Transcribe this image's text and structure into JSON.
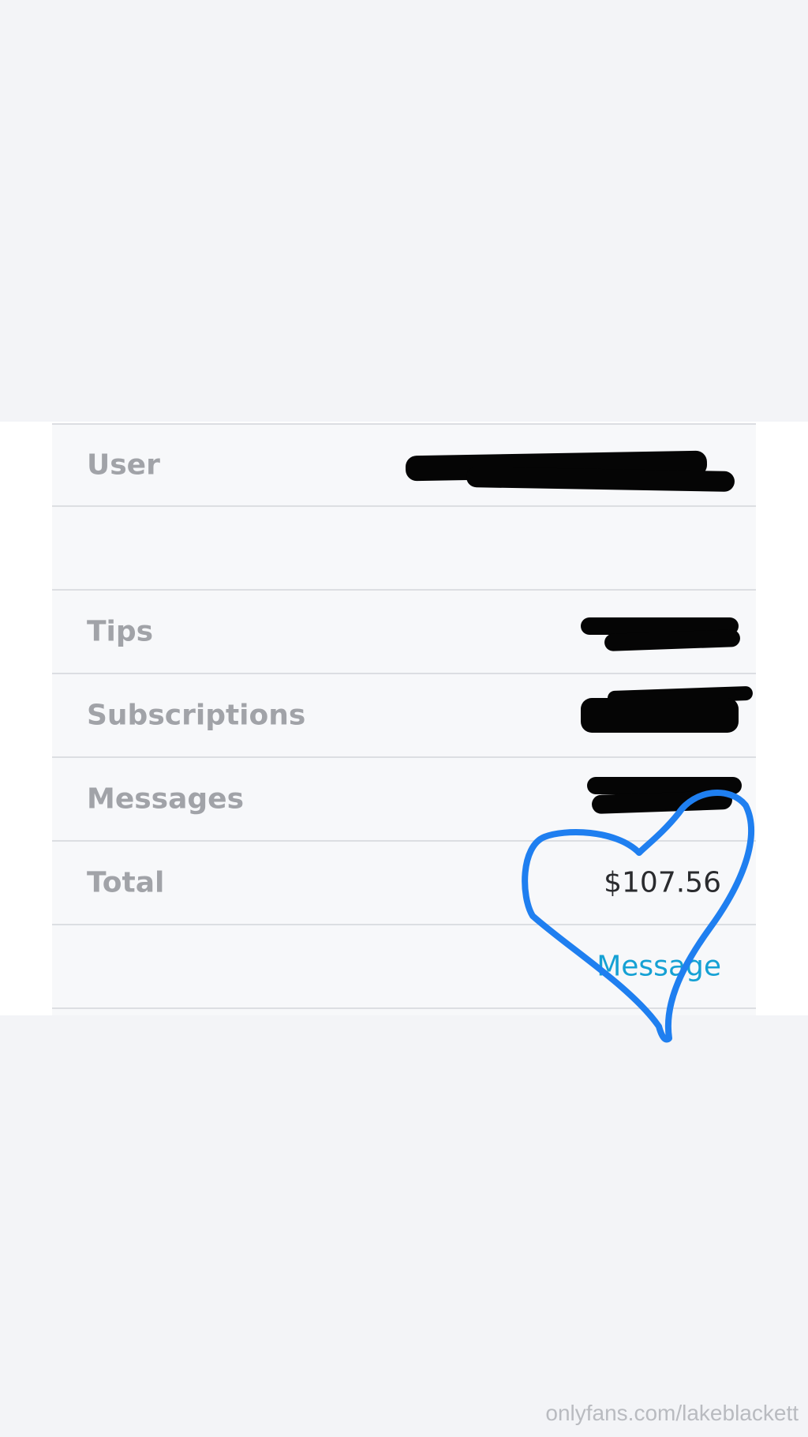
{
  "rows": [
    {
      "label": "User"
    },
    {
      "label": ""
    },
    {
      "label": "Tips"
    },
    {
      "label": "Subscriptions"
    },
    {
      "label": "Messages"
    },
    {
      "label": "Total",
      "value": "$107.56"
    }
  ],
  "actions": {
    "message_label": "Message"
  },
  "watermark": "onlyfans.com/lakeblackett",
  "colors": {
    "background": "#f3f4f7",
    "card": "#f7f8fa",
    "label_text": "#a1a3a8",
    "link": "#15a1d4",
    "heart": "#1f7ff0",
    "redaction": "#050505"
  },
  "annotations": {
    "heart_drawing": "heart-doodle",
    "redactions": "scribble"
  }
}
